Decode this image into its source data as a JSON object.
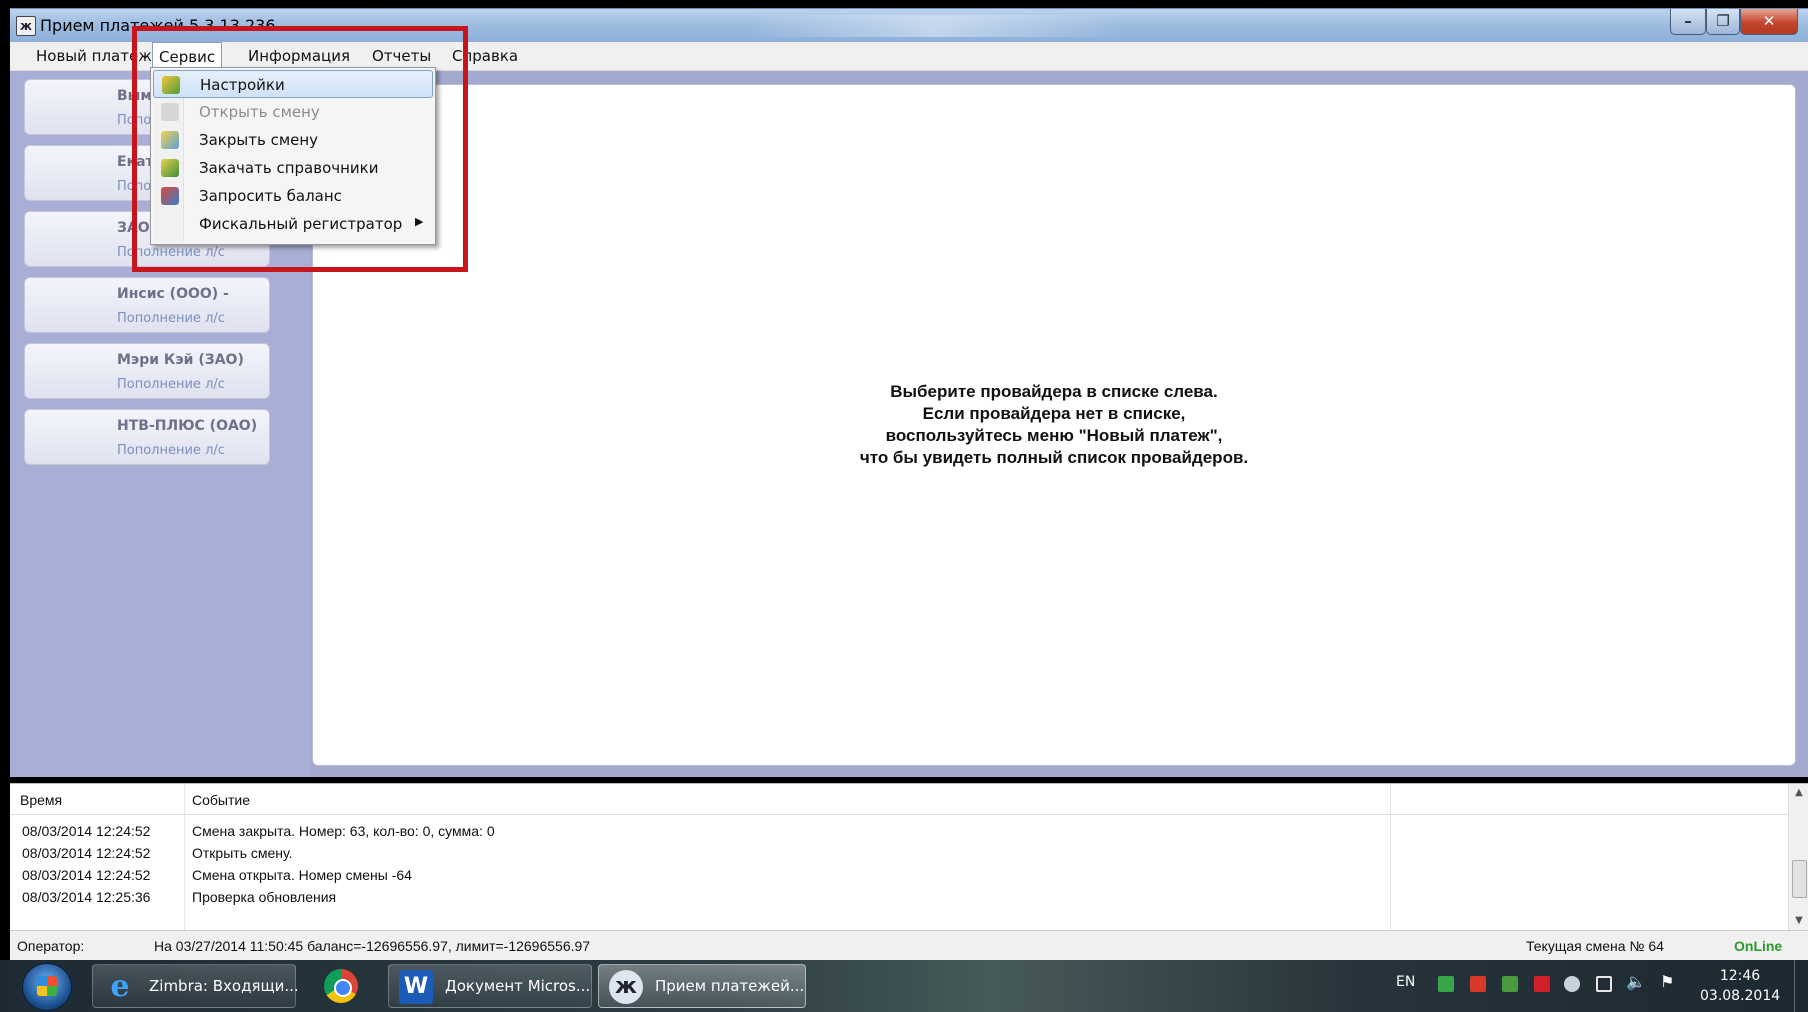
{
  "window": {
    "title": "Прием платежей 5.3.13.236",
    "app_icon": "ж",
    "buttons": {
      "minimize": "–",
      "restore": "❐",
      "close": "✕"
    }
  },
  "menu": {
    "items": [
      "Новый платеж",
      "Сервис",
      "Информация",
      "Отчеты",
      "Справка"
    ]
  },
  "service_menu": {
    "items": [
      {
        "label": "Настройки",
        "icon": "settings-icon",
        "enabled": true
      },
      {
        "label": "Открыть смену",
        "icon": "open-shift-icon",
        "enabled": false
      },
      {
        "label": "Закрыть смену",
        "icon": "close-shift-icon",
        "enabled": true
      },
      {
        "label": "Закачать справочники",
        "icon": "download-directories-icon",
        "enabled": true
      },
      {
        "label": "Запросить баланс",
        "icon": "request-balance-icon",
        "enabled": true
      },
      {
        "label": "Фискальный регистратор",
        "icon": "",
        "enabled": true,
        "submenu": "▶"
      }
    ]
  },
  "providers": [
    {
      "name": "Вымп",
      "sub": "Попо"
    },
    {
      "name": "Екате",
      "sub": "Попо"
    },
    {
      "name": "ЗАО",
      "sub": "Пополнение л/с"
    },
    {
      "name": "Инсис (ООО) -",
      "sub": "Пополнение л/с"
    },
    {
      "name": "Мэри Кэй (ЗАО)",
      "sub": "Пополнение л/с"
    },
    {
      "name": "НТВ-ПЛЮС (ОАО)",
      "sub": "Пополнение л/с"
    }
  ],
  "main": {
    "hint": [
      "Выберите провайдера в списке слева.",
      "Если провайдера нет в списке,",
      "воспользуйтесь меню \"Новый платеж\",",
      "что бы увидеть полный список провайдеров."
    ]
  },
  "log": {
    "columns": [
      "Время",
      "Событие"
    ],
    "rows": [
      {
        "time": "08/03/2014 12:24:52",
        "event": "Смена закрыта. Номер: 63, кол-во: 0, сумма: 0"
      },
      {
        "time": "08/03/2014 12:24:52",
        "event": "Открыть смену."
      },
      {
        "time": "08/03/2014 12:24:52",
        "event": "Смена открыта. Номер смены -64"
      },
      {
        "time": "08/03/2014 12:25:36",
        "event": "Проверка обновления"
      }
    ]
  },
  "status": {
    "operator_label": "Оператор:",
    "balance_text": "На 03/27/2014 11:50:45 баланс=-12696556.97, лимит=-12696556.97",
    "shift_text": "Текущая смена № 64",
    "online": "OnLine",
    "online_color": "#2a9a2a"
  },
  "taskbar": {
    "buttons": [
      {
        "label": "Zimbra: Входящи...",
        "icon": "internet-explorer-icon"
      },
      {
        "label": "",
        "icon": "chrome-icon"
      },
      {
        "label": "Документ Micros...",
        "icon": "word-icon"
      },
      {
        "label": "Прием платежей...",
        "icon": "payments-app-icon"
      }
    ],
    "ie_glyph": "e",
    "word_glyph": "W",
    "app_glyph": "ж",
    "language": "EN",
    "time": "12:46",
    "date": "03.08.2014"
  },
  "colors": {
    "highlight": "#c8151b",
    "panel": "#a8aed5",
    "accent": "#7da2ce"
  }
}
